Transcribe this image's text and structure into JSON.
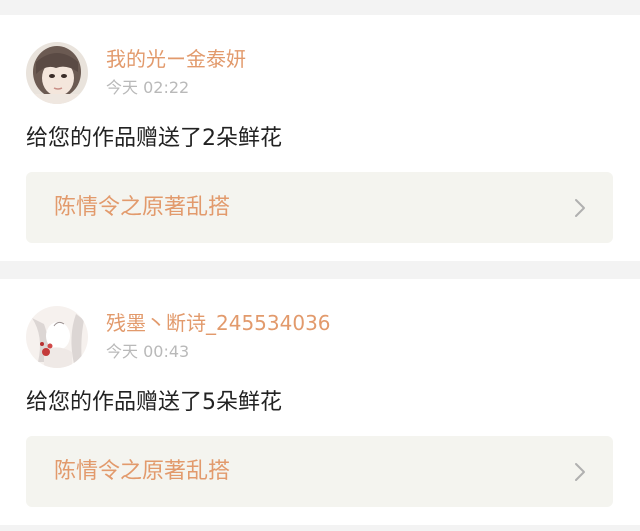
{
  "notifications": [
    {
      "username": "我的光ー金泰妍",
      "time": "今天 02:22",
      "message": "给您的作品赠送了2朵鲜花",
      "work_title": "陈情令之原著乱搭",
      "avatar_icon": "user-avatar-photo"
    },
    {
      "username": "残墨丶断诗_245534036",
      "time": "今天 00:43",
      "message": "给您的作品赠送了5朵鲜花",
      "work_title": "陈情令之原著乱搭",
      "avatar_icon": "user-avatar-illustration"
    }
  ],
  "colors": {
    "background": "#f3f3f3",
    "card": "#ffffff",
    "accent": "#e29a6c",
    "link_box": "#f4f4ef",
    "timestamp": "#b9b9b9",
    "message": "#222222"
  },
  "icons": {
    "chevron": "chevron-right-icon"
  }
}
